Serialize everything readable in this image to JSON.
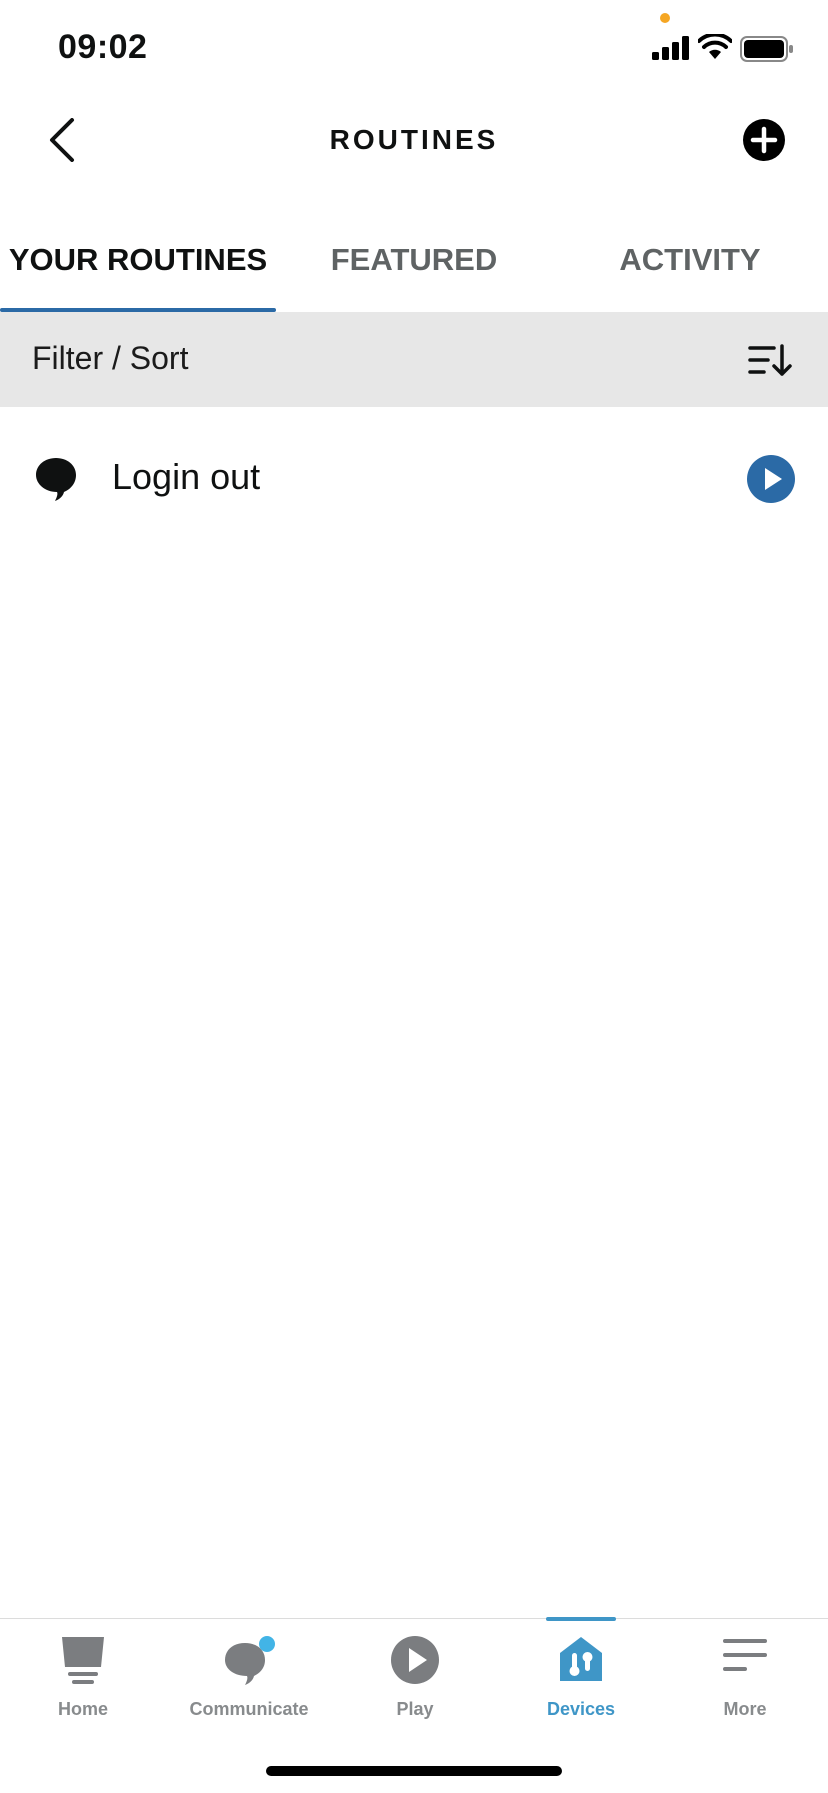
{
  "status_bar": {
    "time": "09:02",
    "icons": [
      "signal-icon",
      "wifi-icon",
      "battery-icon"
    ],
    "privacy_dot_color": "#f5a623"
  },
  "header": {
    "title": "ROUTINES",
    "back_icon": "chevron-left-icon",
    "add_icon": "plus-circle-icon"
  },
  "tabs": [
    {
      "label": "YOUR ROUTINES",
      "active": true
    },
    {
      "label": "FEATURED",
      "active": false
    },
    {
      "label": "ACTIVITY",
      "active": false
    }
  ],
  "filter_bar": {
    "label": "Filter / Sort",
    "icon": "sort-icon"
  },
  "routines": [
    {
      "label": "Login out",
      "icon": "speech-bubble-icon",
      "action_icon": "play-icon"
    }
  ],
  "bottom_nav": [
    {
      "label": "Home",
      "icon": "home-icon",
      "active": false
    },
    {
      "label": "Communicate",
      "icon": "communicate-icon",
      "active": false,
      "badge": true
    },
    {
      "label": "Play",
      "icon": "play-circle-icon",
      "active": false
    },
    {
      "label": "Devices",
      "icon": "devices-icon",
      "active": true
    },
    {
      "label": "More",
      "icon": "menu-icon",
      "active": false
    }
  ],
  "colors": {
    "accent": "#2b6aa6",
    "nav_active": "#3f96c7",
    "filter_bg": "#e7e7e7",
    "badge": "#42b4e6"
  }
}
